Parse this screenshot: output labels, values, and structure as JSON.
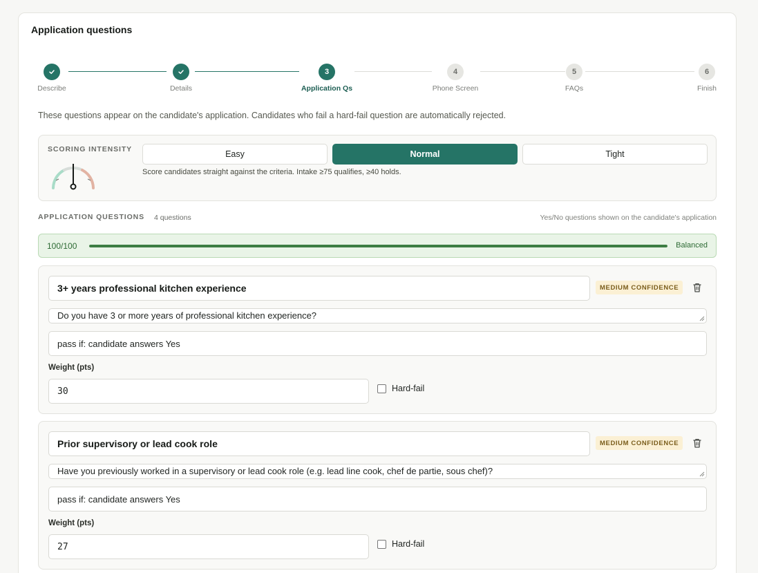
{
  "card_title": "Application questions",
  "steps": [
    {
      "number": "1",
      "label": "Describe",
      "state": "done"
    },
    {
      "number": "2",
      "label": "Details",
      "state": "done"
    },
    {
      "number": "3",
      "label": "Application Qs",
      "state": "active"
    },
    {
      "number": "4",
      "label": "Phone Screen",
      "state": "todo"
    },
    {
      "number": "5",
      "label": "FAQs",
      "state": "todo"
    },
    {
      "number": "6",
      "label": "Finish",
      "state": "todo"
    }
  ],
  "intro": "These questions appear on the candidate's application. Candidates who fail a hard-fail question are automatically rejected.",
  "scoring": {
    "label": "SCORING INTENSITY",
    "options": [
      "Easy",
      "Normal",
      "Tight"
    ],
    "selected": "Normal",
    "description": "Score candidates straight against the criteria. Intake ≥75 qualifies, ≥40 holds."
  },
  "questions_section": {
    "heading": "APPLICATION QUESTIONS",
    "count": "4 questions",
    "note": "Yes/No questions shown on the candidate's application"
  },
  "score": {
    "text": "100/100",
    "value": 100,
    "max": 100,
    "status": "Balanced"
  },
  "questions": [
    {
      "title": "3+ years professional kitchen experience",
      "badge": "MEDIUM CONFIDENCE",
      "text": "Do you have 3 or more years of professional kitchen experience?",
      "rule": "pass if: candidate answers Yes",
      "weight_label": "Weight (pts)",
      "weight": "30",
      "hard_fail_label": "Hard-fail",
      "hard_fail": false
    },
    {
      "title": "Prior supervisory or lead cook role",
      "badge": "MEDIUM CONFIDENCE",
      "text": "Have you previously worked in a supervisory or lead cook role (e.g. lead line cook, chef de partie, sous chef)?",
      "rule": "pass if: candidate answers Yes",
      "weight_label": "Weight (pts)",
      "weight": "27",
      "hard_fail_label": "Hard-fail",
      "hard_fail": false
    }
  ],
  "colors": {
    "accent": "#257466",
    "badge_bg": "#fbf0d4",
    "score_bg": "#e9f4e7",
    "score_fill": "#3d7d43"
  }
}
